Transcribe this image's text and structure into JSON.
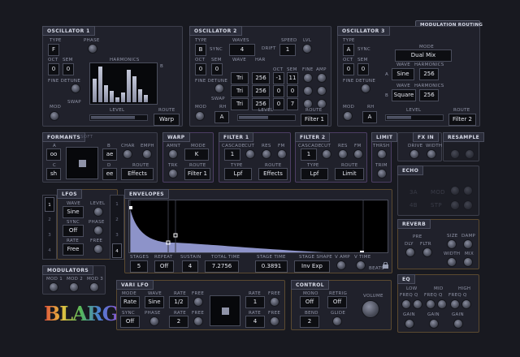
{
  "header": {
    "modulation_routing": "MODULATION ROUTING"
  },
  "osc1": {
    "title": "OSCILLATOR 1",
    "type_lbl": "TYPE",
    "type": "F",
    "phase_lbl": "PHASE",
    "oct_lbl": "OCT",
    "oct": "0",
    "sem_lbl": "SEM",
    "sem": "0",
    "harm_lbl": "HARMONICS",
    "harm_a": "A",
    "harm_b": "B",
    "fine_lbl": "FINE DETUNE",
    "swap": "SWAP",
    "mod_lbl": "MOD",
    "level_lbl": "LEVEL",
    "route_lbl": "ROUTE",
    "route": "Warp",
    "harmonics": [
      0.62,
      0.95,
      0.45,
      0.3,
      0.12,
      0.25,
      0.88,
      0.7,
      0.35,
      0.2
    ]
  },
  "osc2": {
    "title": "OSCILLATOR 2",
    "type_lbl": "TYPE",
    "type": "B",
    "sync": "SYNC",
    "waves_lbl": "WAVES",
    "waves": "4",
    "drift": "DRIFT",
    "speed_lbl": "SPEED",
    "speed": "1",
    "lvl_lbl": "LVL",
    "oct_lbl": "OCT",
    "oct": "0",
    "sem_lbl": "SEM",
    "sem": "0",
    "wave_lbl": "WAVE",
    "har_lbl": "HAR",
    "oct2_lbl": "OCT",
    "sem2_lbl": "SEM",
    "fine_lbl": "FINE",
    "amp_lbl": "AMP",
    "rows": [
      {
        "wave": "Tri",
        "har": "256",
        "oct": "-1",
        "sem": "11"
      },
      {
        "wave": "Tri",
        "har": "256",
        "oct": "0",
        "sem": "0"
      },
      {
        "wave": "Tri",
        "har": "256",
        "oct": "0",
        "sem": "7"
      }
    ],
    "fine_detune_lbl": "FINE DETUNE",
    "swap": "SWAP",
    "mod_lbl": "MOD",
    "rh_lbl": "RH",
    "rh": "A",
    "level_lbl": "LEVEL",
    "route_lbl": "ROUTE",
    "route": "Filter 1"
  },
  "osc3": {
    "title": "OSCILLATOR 3",
    "type_lbl": "TYPE",
    "type": "A",
    "sync": "SYNC",
    "oct_lbl": "OCT",
    "oct": "0",
    "sem_lbl": "SEM",
    "sem": "0",
    "mode_lbl": "MODE",
    "mode": "Dual Mix",
    "wave_lbl": "WAVE",
    "harm_lbl": "HARMONICS",
    "a_lbl": "A",
    "wave_a": "Sine",
    "harm_a": "256",
    "b_lbl": "B",
    "wave_b": "Square",
    "harm_b": "256",
    "fine_lbl": "FINE DETUNE",
    "mod_lbl": "MOD",
    "rh_lbl": "RH",
    "rh": "A",
    "level_lbl": "LEVEL",
    "route_lbl": "ROUTE",
    "route": "Filter 2"
  },
  "formants": {
    "title": "FORMANTS",
    "sub": "SOFT",
    "a_lbl": "A",
    "a": "oo",
    "b_lbl": "B",
    "b": "ae",
    "c_lbl": "C",
    "c": "sh",
    "d_lbl": "D",
    "d": "ee",
    "char_lbl": "CHAR",
    "emph_lbl": "EMPH",
    "route_lbl": "ROUTE",
    "route": "Effects"
  },
  "warp": {
    "title": "WARP",
    "amnt_lbl": "AMNT",
    "mode_lbl": "MODE",
    "mode": "K",
    "trk_lbl": "TRK",
    "route_lbl": "ROUTE",
    "route": "Filter 1"
  },
  "filter1": {
    "title": "FILTER 1",
    "cascade_lbl": "CASCADE",
    "cascade": "1",
    "cut_lbl": "CUT",
    "res_lbl": "RES",
    "fm_lbl": "FM",
    "type_lbl": "TYPE",
    "type": "Lpf",
    "route_lbl": "ROUTE",
    "route": "Effects"
  },
  "filter2": {
    "title": "FILTER 2",
    "cascade_lbl": "CASCADE",
    "cascade": "1",
    "cut_lbl": "CUT",
    "res_lbl": "RES",
    "fm_lbl": "FM",
    "type_lbl": "TYPE",
    "type": "Lpf",
    "route_lbl": "ROUTE",
    "route": "Limit"
  },
  "limit": {
    "title": "LIMIT",
    "thrsh_lbl": "THRSH",
    "trim_lbl": "TRIM"
  },
  "fxin": {
    "title": "FX IN",
    "drive_lbl": "DRIVE",
    "width_lbl": "WIDTH"
  },
  "resample": {
    "title": "RESAMPLE"
  },
  "echo": {
    "title": "ECHO",
    "faint": [
      "3A",
      "MOD",
      "4B",
      "STP"
    ]
  },
  "reverb": {
    "title": "REVERB",
    "pre_lbl": "PRE",
    "dly_lbl": "DLY",
    "fltr_lbl": "FLTR",
    "size_lbl": "SIZE",
    "damp_lbl": "DAMP",
    "width_lbl": "WIDTH",
    "mix_lbl": "MIX"
  },
  "eq": {
    "title": "EQ",
    "low_lbl": "LOW",
    "mid_lbl": "MID",
    "high_lbl": "HIGH",
    "freq_lbl": "FREQ",
    "q_lbl": "Q",
    "gain_lbl": "GAIN"
  },
  "lfos": {
    "title": "LFOS",
    "tabs": [
      "1",
      "2",
      "3",
      "4"
    ],
    "wave_lbl": "WAVE",
    "wave": "Sine",
    "level_lbl": "LEVEL",
    "sync_lbl": "SYNC",
    "sync": "Off",
    "phase_lbl": "PHASE",
    "rate_lbl": "RATE",
    "rate": "Free",
    "free_lbl": "FREE"
  },
  "envelopes": {
    "title": "ENVELOPES",
    "tabs": [
      "1",
      "2",
      "3",
      "4"
    ],
    "stages_lbl": "STAGES",
    "stages": "5",
    "repeat_lbl": "REPEAT",
    "repeat": "Off",
    "sustain_lbl": "SUSTAIN",
    "sustain": "4",
    "total_lbl": "TOTAL TIME",
    "total": "7.2756",
    "stage_time_lbl": "STAGE TIME",
    "stage_time": "0.3891",
    "shape_lbl": "STAGE SHAPE",
    "shape": "Inv Exp",
    "vamp_lbl": "V AMP",
    "vtime_lbl": "V TIME",
    "beats": "BEATS"
  },
  "modulators": {
    "title": "MODULATORS",
    "mod1": "MOD 1",
    "mod2": "MOD 2",
    "mod3": "MOD 3"
  },
  "vari_lfo": {
    "title": "VARI LFO",
    "mode_lbl": "MODE",
    "mode": "Rate",
    "wave_lbl": "WAVE",
    "wave": "Sine",
    "rate_lbl": "RATE",
    "rate": "1/2",
    "free_lbl": "FREE",
    "sync_lbl": "SYNC",
    "sync": "Off",
    "phase_lbl": "PHASE",
    "rate2": "2",
    "rate3": "1",
    "rate4": "4"
  },
  "control": {
    "title": "CONTROL",
    "mono_lbl": "MONO",
    "mono": "Off",
    "retrig_lbl": "RETRIG",
    "retrig": "Off",
    "bend_lbl": "BEND",
    "bend": "2",
    "glide_lbl": "GLIDE",
    "volume_lbl": "VOLUME"
  },
  "logo": {
    "text": "BLARG"
  }
}
